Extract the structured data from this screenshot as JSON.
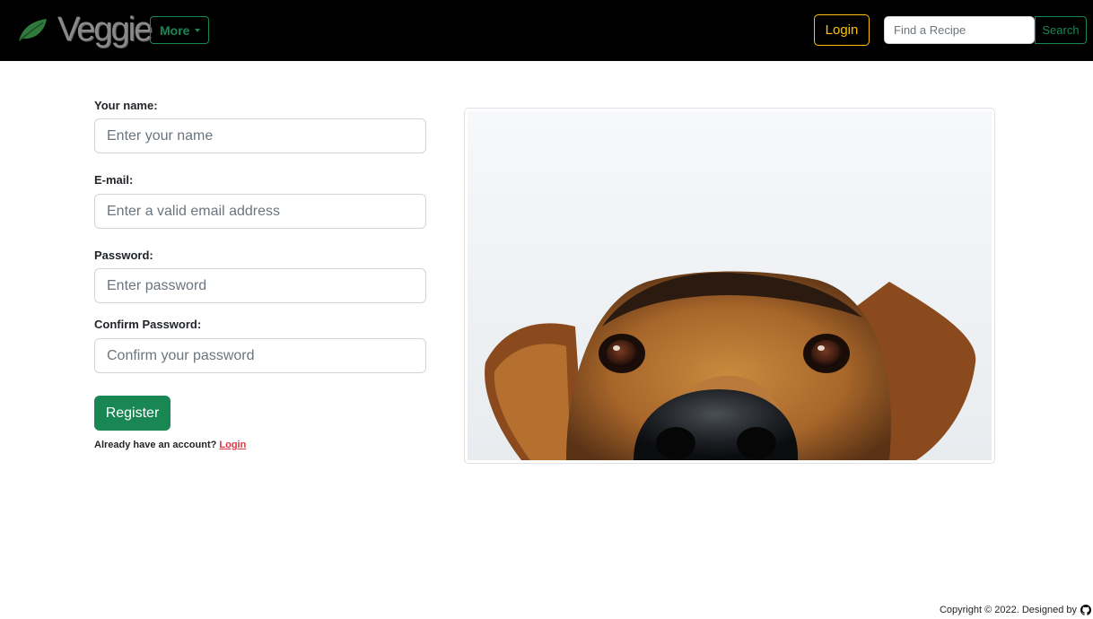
{
  "navbar": {
    "brand": "Veggie",
    "brand_icon": "leaf-icon",
    "more_label": "More",
    "login_label": "Login",
    "search_placeholder": "Find a Recipe",
    "search_label": "Search"
  },
  "form": {
    "name_label": "Your name:",
    "name_placeholder": "Enter your name",
    "email_label": "E-mail:",
    "email_placeholder": "Enter a valid email address",
    "password_label": "Password:",
    "password_placeholder": "Enter password",
    "confirm_label": "Confirm Password:",
    "confirm_placeholder": "Confirm your password",
    "register_label": "Register",
    "account_text": "Already have an account?",
    "account_link": "Login"
  },
  "image": {
    "subject": "dog-photo"
  },
  "footer": {
    "copyright": "Copyright © 2022. Designed by",
    "icon": "github-icon"
  },
  "colors": {
    "nav_bg": "#000000",
    "accent_green": "#198754",
    "accent_yellow": "#ffc107",
    "link_red": "#dc3545",
    "brand_grey": "#8a8a8a"
  }
}
